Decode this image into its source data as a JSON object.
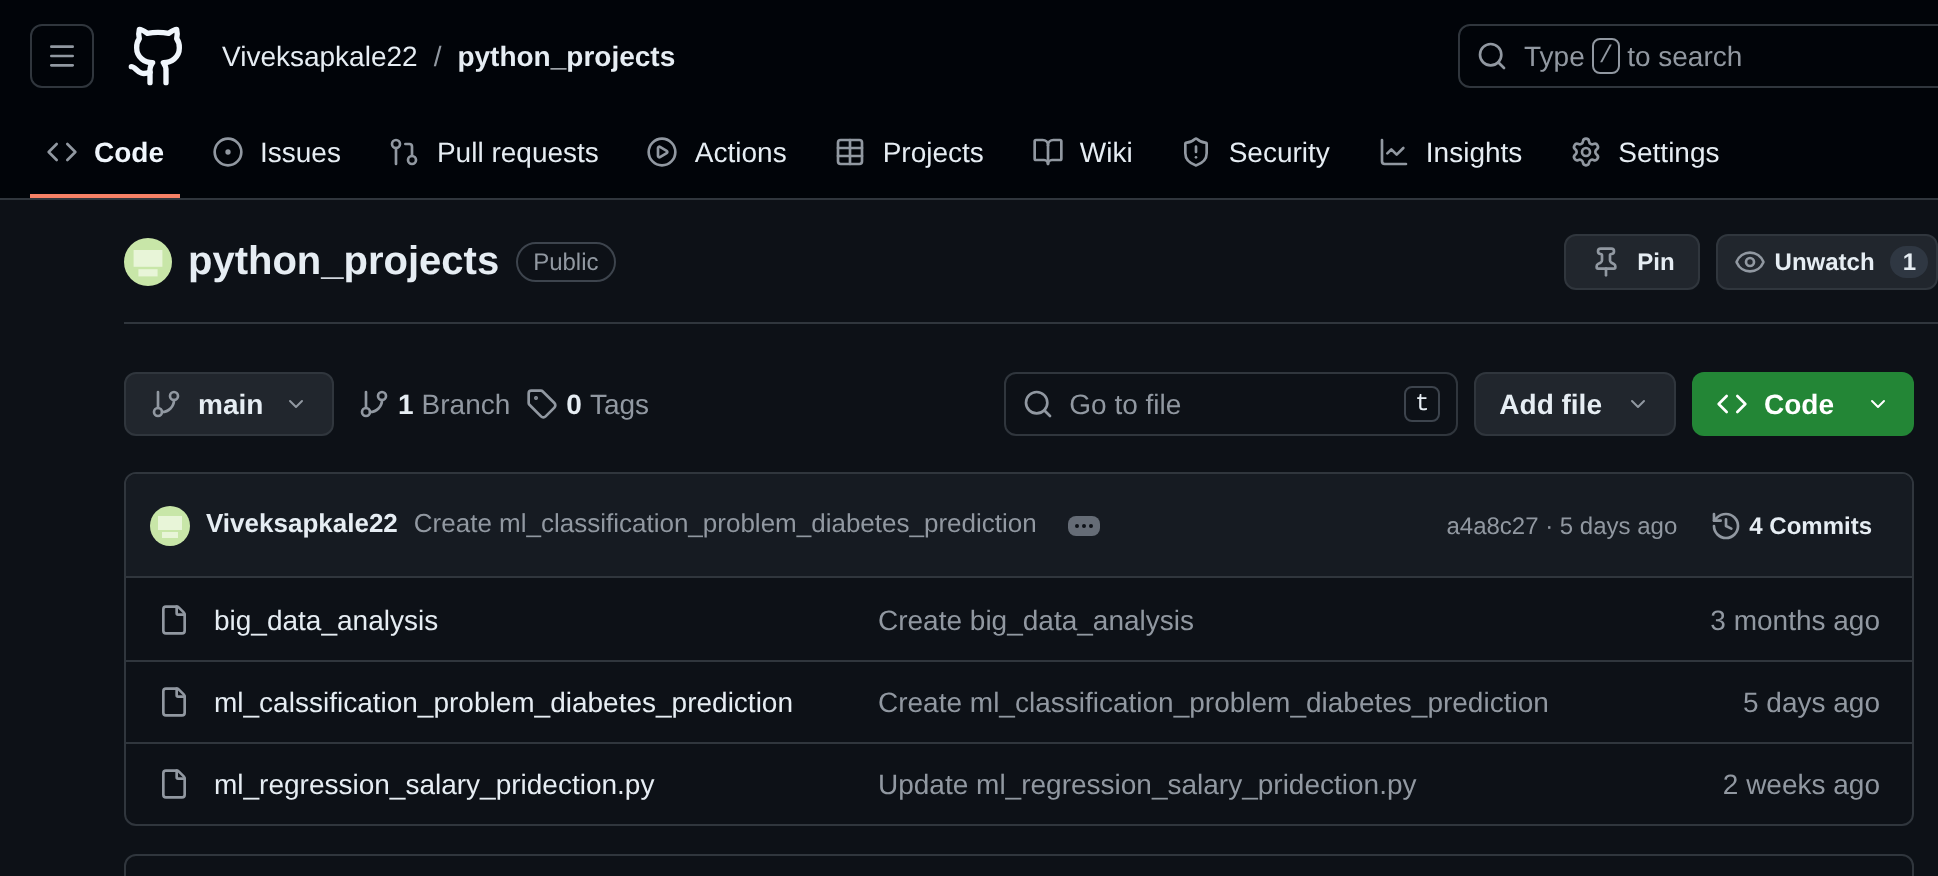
{
  "header": {
    "owner": "Viveksapkale22",
    "separator": "/",
    "repo": "python_projects",
    "search": {
      "before": "Type",
      "key": "/",
      "after": "to search"
    }
  },
  "tabs": [
    {
      "label": "Code",
      "selected": true
    },
    {
      "label": "Issues",
      "selected": false
    },
    {
      "label": "Pull requests",
      "selected": false
    },
    {
      "label": "Actions",
      "selected": false
    },
    {
      "label": "Projects",
      "selected": false
    },
    {
      "label": "Wiki",
      "selected": false
    },
    {
      "label": "Security",
      "selected": false
    },
    {
      "label": "Insights",
      "selected": false
    },
    {
      "label": "Settings",
      "selected": false
    }
  ],
  "repo": {
    "name": "python_projects",
    "visibility": "Public",
    "pin": "Pin",
    "watch": {
      "label": "Unwatch",
      "count": "1"
    }
  },
  "toolbar": {
    "branch": "main",
    "branches": {
      "count": "1",
      "label": "Branch"
    },
    "tags": {
      "count": "0",
      "label": "Tags"
    },
    "file_search": {
      "placeholder": "Go to file",
      "key": "t"
    },
    "add_file": "Add file",
    "code": "Code"
  },
  "latest_commit": {
    "author": "Viveksapkale22",
    "message": "Create ml_classification_problem_diabetes_prediction",
    "hash_time": "a4a8c27 · 5 days ago",
    "commits": "4 Commits"
  },
  "files": [
    {
      "name": "big_data_analysis",
      "message": "Create big_data_analysis",
      "time": "3 months ago"
    },
    {
      "name": "ml_calssification_problem_diabetes_prediction",
      "message": "Create ml_classification_problem_diabetes_prediction",
      "time": "5 days ago"
    },
    {
      "name": "ml_regression_salary_pridection.py",
      "message": "Update ml_regression_salary_pridection.py",
      "time": "2 weeks ago"
    }
  ]
}
